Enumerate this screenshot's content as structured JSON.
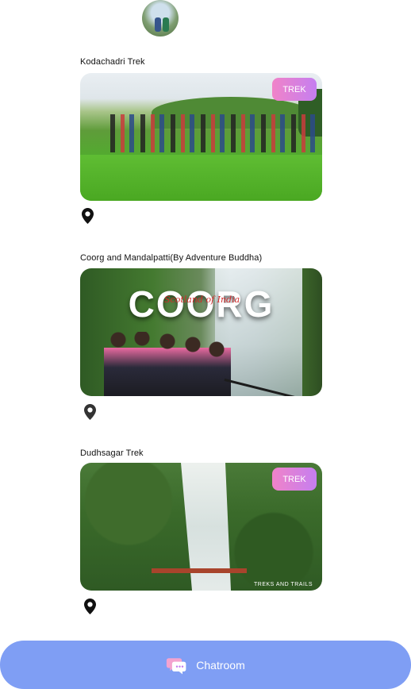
{
  "profile": {
    "avatar_icon": "user-avatar-icon"
  },
  "cards": [
    {
      "title": "Kodachadri Trek",
      "tag": "TREK",
      "location_icon": "location-pin-icon"
    },
    {
      "title": "Coorg and Mandalpatti(By Adventure Buddha)",
      "overlay_title": "COORG",
      "overlay_script": "Scotland of India",
      "location_icon": "location-pin-icon"
    },
    {
      "title": "Dudhsagar Trek",
      "tag": "TREK",
      "watermark": "TREKS AND TRAILS",
      "location_icon": "location-pin-icon"
    }
  ],
  "chatroom": {
    "label": "Chatroom",
    "icon": "chat-bubbles-icon"
  },
  "colors": {
    "tag_gradient_start": "#f083c8",
    "tag_gradient_end": "#c57ef0",
    "chat_bar": "#7f9ef4"
  }
}
